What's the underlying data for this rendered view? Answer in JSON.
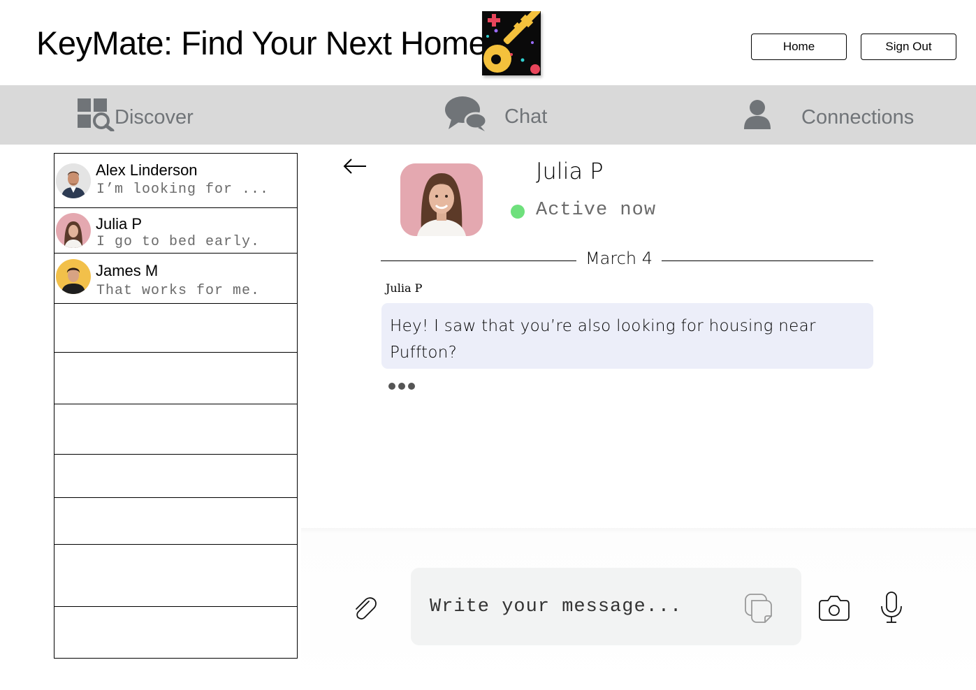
{
  "header": {
    "title": "KeyMate: Find Your Next Home",
    "logo_icon": "key-logo-icon",
    "buttons": {
      "home": "Home",
      "sign_out": "Sign Out"
    }
  },
  "nav": {
    "items": [
      {
        "label": "Discover",
        "icon": "discover-icon"
      },
      {
        "label": "Chat",
        "icon": "chat-bubbles-icon"
      },
      {
        "label": "Connections",
        "icon": "user-icon"
      }
    ]
  },
  "chat_list": {
    "conversations": [
      {
        "name": "Alex Linderson",
        "preview": "I’m looking for ..."
      },
      {
        "name": "Julia P",
        "preview": "I go to bed early."
      },
      {
        "name": "James M",
        "preview": "That works for me."
      }
    ]
  },
  "conversation": {
    "contact_name": "Julia P",
    "status": "Active now",
    "date": "March 4",
    "messages": [
      {
        "sender": "Julia P",
        "text": "Hey! I saw that you’re also looking for housing near Puffton?"
      }
    ]
  },
  "composer": {
    "placeholder": "Write your message..."
  },
  "colors": {
    "nav_bg": "#d9d9d9",
    "nav_text": "#707478",
    "bubble_bg": "#eceef9",
    "status_active": "#6ee07c",
    "input_bg": "#f2f3f3"
  }
}
